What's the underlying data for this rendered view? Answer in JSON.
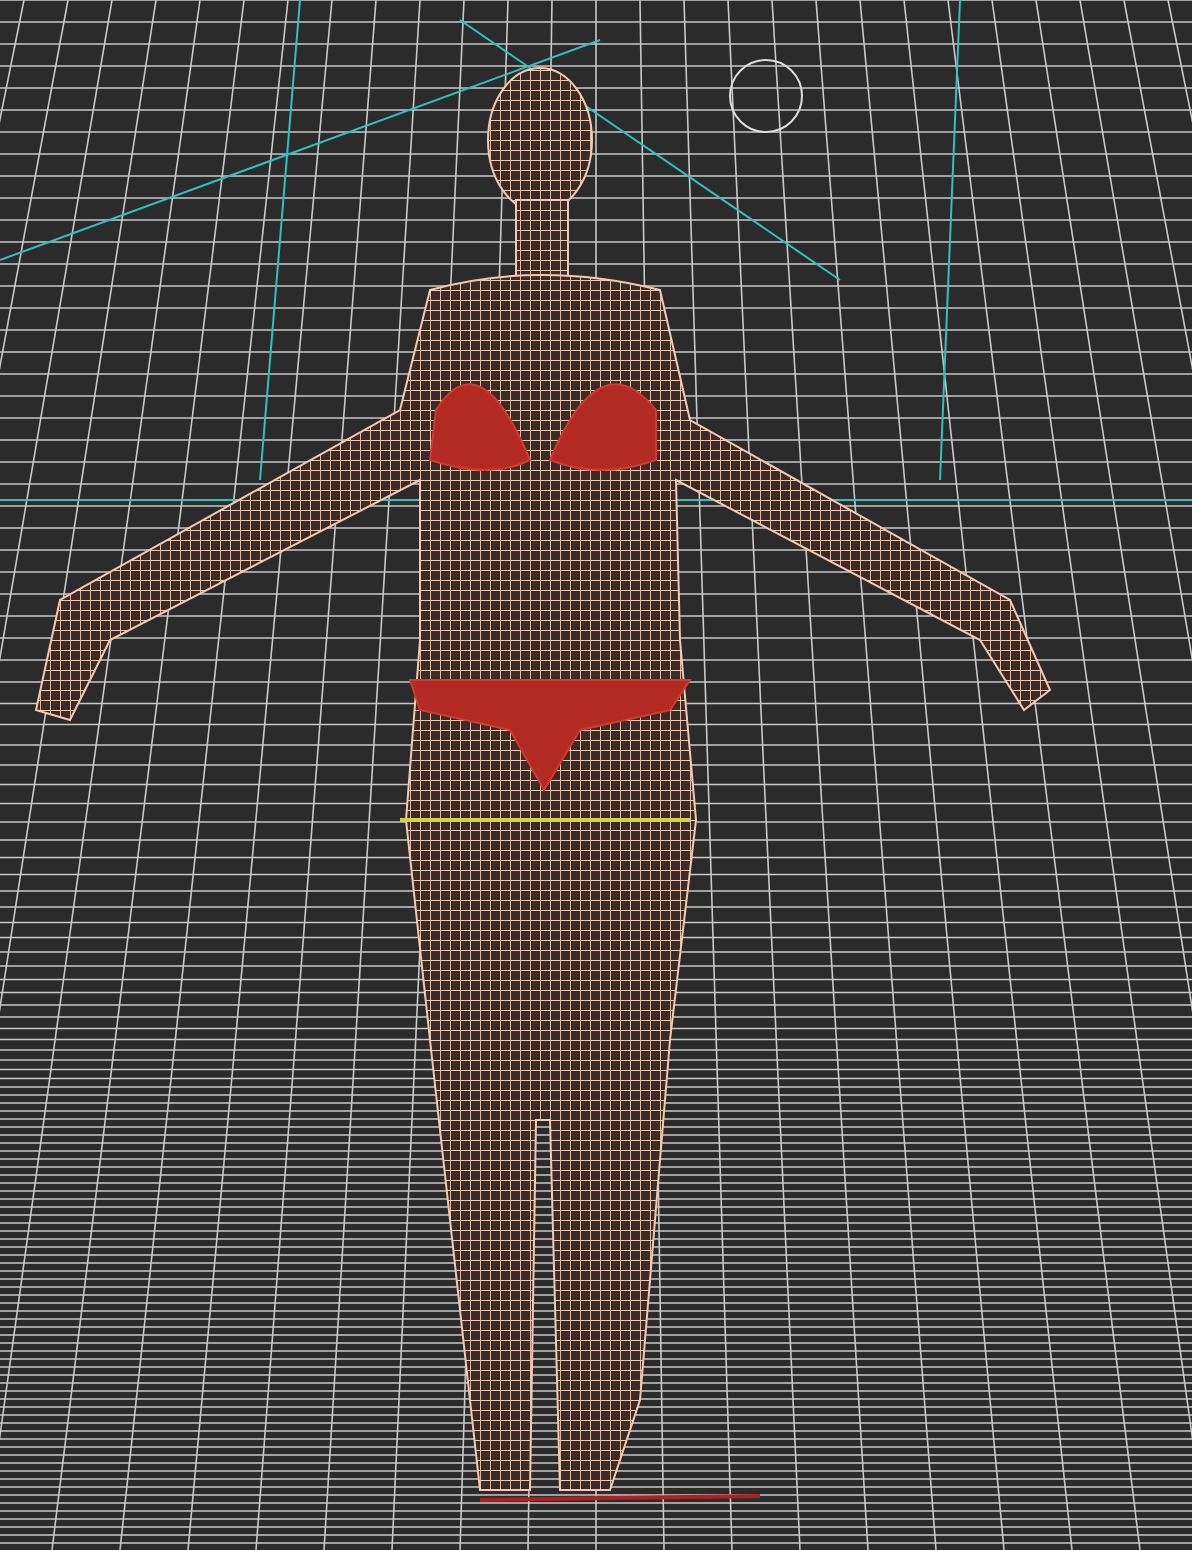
{
  "viewport": {
    "kind": "perspective",
    "grid_visible": true,
    "figure_visible": true
  }
}
